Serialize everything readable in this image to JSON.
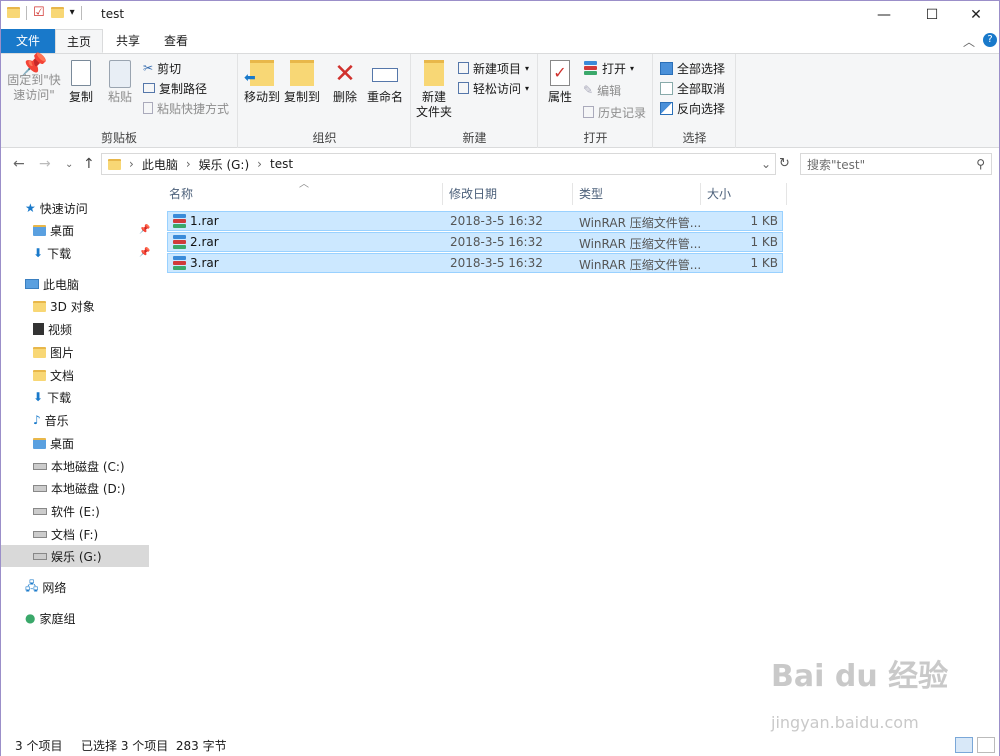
{
  "window": {
    "title": "test",
    "qat_dropdown": "▾"
  },
  "tabs": {
    "file": "文件",
    "home": "主页",
    "share": "共享",
    "view": "查看"
  },
  "ribbon": {
    "clipboard": {
      "label": "剪贴板",
      "pin": "固定到\"快速访问\"",
      "copy": "复制",
      "paste": "粘贴",
      "cut": "剪切",
      "copy_path": "复制路径",
      "paste_shortcut": "粘贴快捷方式"
    },
    "organize": {
      "label": "组织",
      "move_to": "移动到",
      "copy_to": "复制到",
      "delete": "删除",
      "rename": "重命名"
    },
    "new": {
      "label": "新建",
      "new_folder": "新建\n文件夹",
      "new_item": "新建项目",
      "easy_access": "轻松访问"
    },
    "open": {
      "label": "打开",
      "properties": "属性",
      "open": "打开",
      "edit": "编辑",
      "history": "历史记录"
    },
    "select": {
      "label": "选择",
      "select_all": "全部选择",
      "select_none": "全部取消",
      "invert": "反向选择"
    }
  },
  "address": {
    "crumbs": [
      "此电脑",
      "娱乐 (G:)",
      "test"
    ],
    "search_placeholder": "搜索\"test\""
  },
  "nav": {
    "quick_access": "快速访问",
    "quick_items": [
      "桌面",
      "下载"
    ],
    "this_pc": "此电脑",
    "pc_items": [
      "3D 对象",
      "视频",
      "图片",
      "文档",
      "下载",
      "音乐",
      "桌面",
      "本地磁盘 (C:)",
      "本地磁盘 (D:)",
      "软件 (E:)",
      "文档 (F:)",
      "娱乐 (G:)"
    ],
    "network": "网络",
    "homegroup": "家庭组"
  },
  "columns": {
    "name": "名称",
    "date": "修改日期",
    "type": "类型",
    "size": "大小"
  },
  "files": [
    {
      "name": "1.rar",
      "date": "2018-3-5 16:32",
      "type": "WinRAR 压缩文件管...",
      "size": "1 KB"
    },
    {
      "name": "2.rar",
      "date": "2018-3-5 16:32",
      "type": "WinRAR 压缩文件管...",
      "size": "1 KB"
    },
    {
      "name": "3.rar",
      "date": "2018-3-5 16:32",
      "type": "WinRAR 压缩文件管...",
      "size": "1 KB"
    }
  ],
  "status": {
    "count": "3 个项目",
    "selected": "已选择 3 个项目  283 字节"
  },
  "watermark": {
    "line1": "Bai du 经验",
    "line2": "jingyan.baidu.com"
  },
  "colors": {
    "accent": "#1979ca",
    "selection": "#cce8ff",
    "selection_border": "#99d1ff"
  }
}
